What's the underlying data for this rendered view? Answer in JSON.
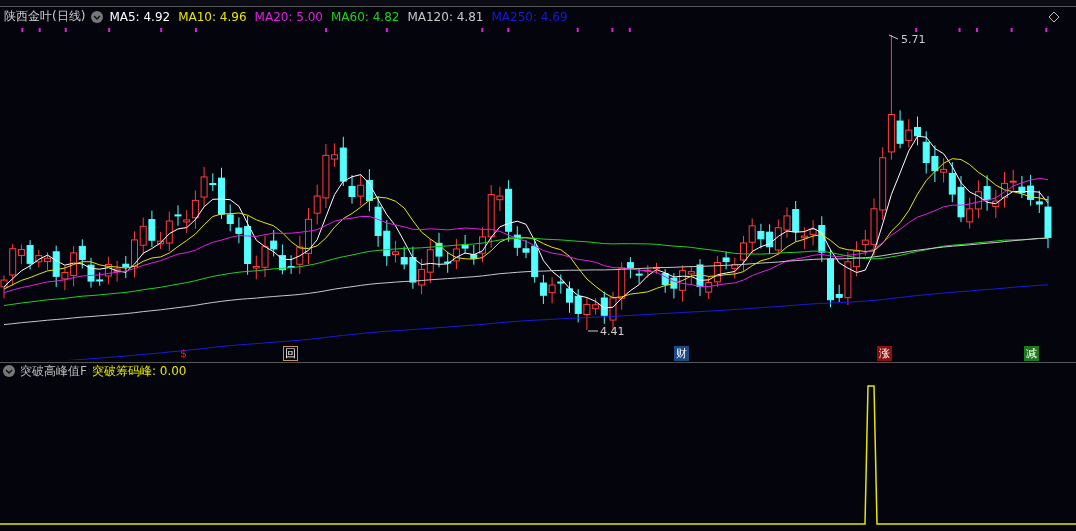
{
  "header": {
    "title": "陕西金叶(日线)",
    "indicators": [
      {
        "label": "MA5: 4.92",
        "color": "#ffffff"
      },
      {
        "label": "MA10: 4.96",
        "color": "#e6e600"
      },
      {
        "label": "MA20: 5.00",
        "color": "#e020e0"
      },
      {
        "label": "MA60: 4.82",
        "color": "#20d020"
      },
      {
        "label": "MA120: 4.81",
        "color": "#c8c8c8"
      },
      {
        "label": "MA250: 4.69",
        "color": "#1a1ad8"
      }
    ]
  },
  "price_chart": {
    "high_label": "5.71",
    "low_label": "4.41",
    "markers": [
      {
        "label": "$",
        "kind": "plain",
        "color": "#e02020"
      },
      {
        "label": "回",
        "kind": "framed",
        "color": "#c8925a"
      },
      {
        "label": "财",
        "kind": "filled",
        "color": "#1e4a84"
      },
      {
        "label": "涨",
        "kind": "filled",
        "color": "#8a1010"
      },
      {
        "label": "减",
        "kind": "filled",
        "color": "#1c7a1c"
      }
    ]
  },
  "indicator_panel": {
    "name": "突破高峰值F",
    "value_label": "突破筹码峰: 0.00"
  }
}
